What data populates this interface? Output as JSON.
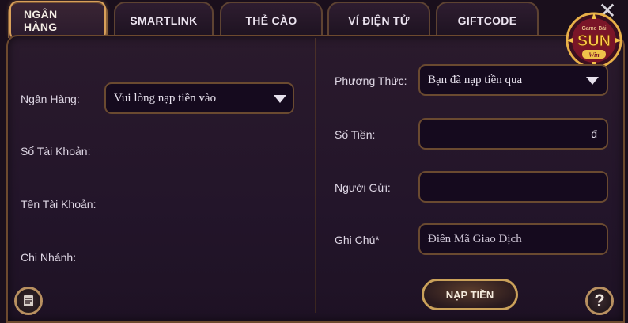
{
  "tabs": [
    {
      "label": "NGÂN HÀNG",
      "active": true
    },
    {
      "label": "SMARTLINK",
      "active": false
    },
    {
      "label": "THẺ CÀO",
      "active": false
    },
    {
      "label": "VÍ ĐIỆN TỬ",
      "active": false
    },
    {
      "label": "GIFTCODE",
      "active": false
    }
  ],
  "logo": {
    "top": "Game Bài",
    "main": "SUN",
    "sub": "Win"
  },
  "left": {
    "bank_label": "Ngân Hàng:",
    "bank_select_value": "Vui lòng nạp tiền vào",
    "account_number_label": "Số Tài Khoản:",
    "account_name_label": "Tên Tài Khoản:",
    "branch_label": "Chi Nhánh:"
  },
  "right": {
    "method_label": "Phương Thức:",
    "method_select_value": "Bạn đã nạp tiền qua",
    "amount_label": "Số Tiền:",
    "amount_currency": "đ",
    "sender_label": "Người Gửi:",
    "note_label": "Ghi Chú*",
    "note_placeholder": "Điền Mã Giao Dịch"
  },
  "submit_label": "NẠP TIỀN",
  "help_label": "?",
  "colors": {
    "accent": "#caa15a",
    "panel": "#23152a",
    "field": "#150a1e"
  }
}
